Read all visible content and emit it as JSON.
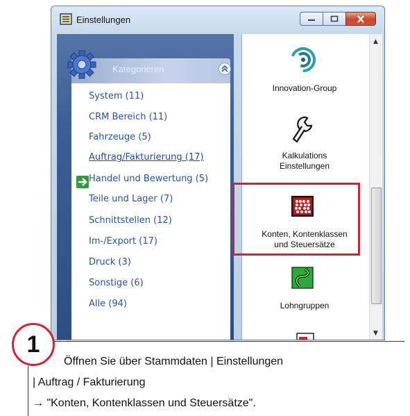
{
  "window": {
    "title": "Einstellungen",
    "icon": "settings-list-icon"
  },
  "sidebar": {
    "header": "Kategorieren",
    "items": [
      {
        "label": "System (11)"
      },
      {
        "label": "CRM Bereich (11)"
      },
      {
        "label": "Fahrzeuge (5)"
      },
      {
        "label": "Auftrag/Fakturierung (17)",
        "active": true
      },
      {
        "label": "Handel und Bewertung (5)"
      },
      {
        "label": "Teile und Lager (7)"
      },
      {
        "label": "Schnittstellen (12)"
      },
      {
        "label": "Im-/Export (17)"
      },
      {
        "label": "Druck (3)"
      },
      {
        "label": "Sonstige (6)"
      },
      {
        "label": "Alle (94)"
      }
    ]
  },
  "modules": [
    {
      "label_1": "Innovation-Group",
      "icon": "innovation-group-logo"
    },
    {
      "label_1": "Kalkulations",
      "label_2": "Einstellungen",
      "icon": "wrench-icon"
    },
    {
      "label_1": "Konten, Kontenklassen",
      "label_2": "und Steuersätze",
      "icon": "abacus-icon",
      "highlighted": true
    },
    {
      "label_1": "Lohngruppen",
      "icon": "lohngruppen-icon"
    }
  ],
  "annotation": {
    "step": "1",
    "line_1": "Öffnen Sie über Stammdaten | Einstellungen",
    "line_2": "| Auftrag / Fakturierung",
    "line_3": "→ \"Konten, Kontenklassen und Steuersätze\"."
  },
  "colors": {
    "highlight": "#d52230",
    "link": "#2454a8"
  }
}
